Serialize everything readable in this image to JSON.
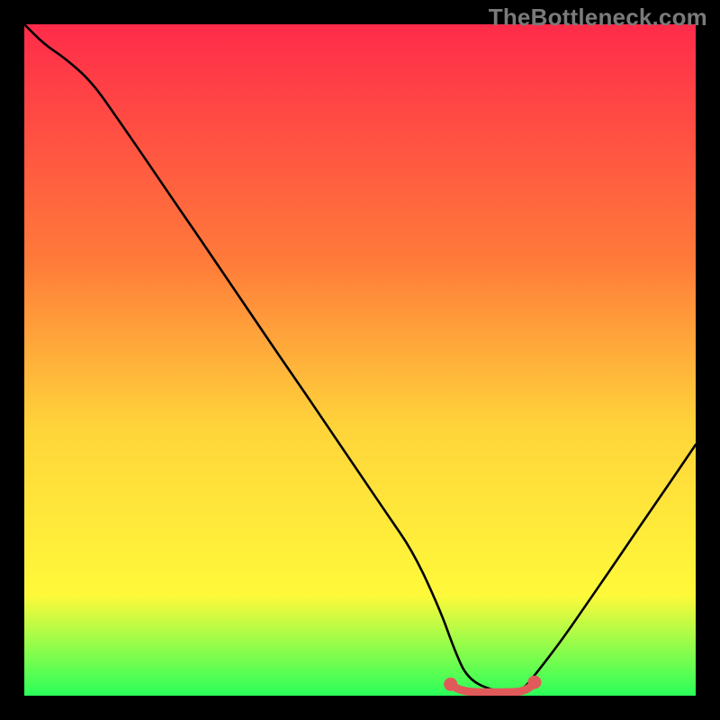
{
  "watermark": {
    "text": "TheBottleneck.com"
  },
  "colors": {
    "grad_top": "#ff2b4a",
    "grad_mid1": "#ff7a3a",
    "grad_mid2": "#ffd43a",
    "grad_mid3": "#fff93a",
    "grad_bot": "#2aff5a",
    "curve_black": "#000000",
    "flat_red": "#e05a5a",
    "flat_red_dot": "#e05a5a"
  },
  "chart_data": {
    "type": "line",
    "title": "",
    "xlabel": "",
    "ylabel": "",
    "xlim": [
      0,
      100
    ],
    "ylim": [
      0,
      100
    ],
    "series": [
      {
        "name": "bottleneck-curve",
        "x": [
          0,
          3,
          6,
          10,
          14,
          18,
          22,
          26,
          30,
          34,
          38,
          42,
          46,
          50,
          54,
          58,
          62,
          64,
          66,
          70,
          74,
          76,
          80,
          84,
          88,
          92,
          96,
          100
        ],
        "y": [
          100,
          97,
          95,
          91.5,
          85.8,
          80.0,
          74.1,
          68.3,
          62.4,
          56.5,
          50.6,
          44.8,
          38.9,
          33.0,
          27.1,
          21.3,
          12.6,
          7.0,
          2.5,
          0.6,
          0.6,
          3.0,
          8.2,
          14.0,
          19.8,
          25.7,
          31.5,
          37.4
        ]
      },
      {
        "name": "flat-region",
        "x": [
          63.5,
          64.5,
          66,
          68,
          70,
          72,
          74,
          75.3,
          76.0
        ],
        "y": [
          1.7,
          1.0,
          0.6,
          0.5,
          0.5,
          0.5,
          0.6,
          1.2,
          2.0
        ]
      }
    ],
    "flat_endpoints": {
      "left": {
        "x": 63.5,
        "y": 1.7
      },
      "right": {
        "x": 76.0,
        "y": 2.0
      }
    }
  }
}
